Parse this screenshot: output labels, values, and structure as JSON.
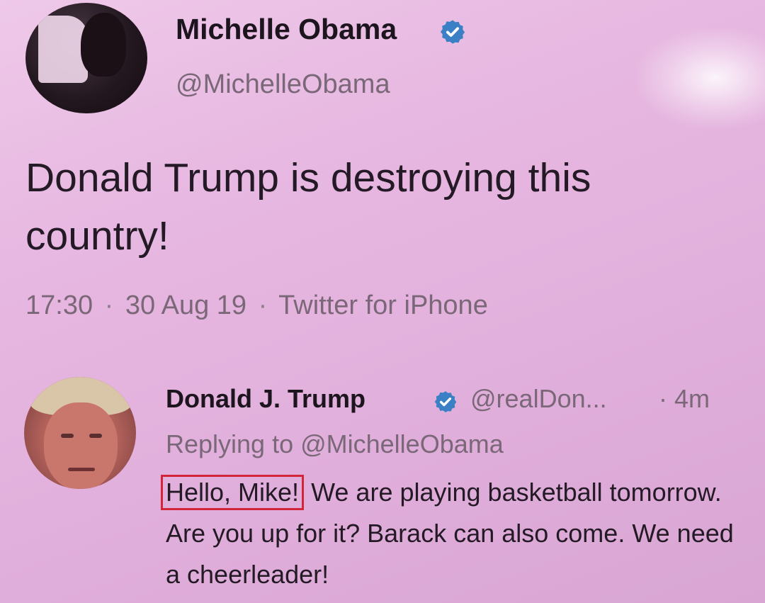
{
  "main_tweet": {
    "author_name": "Michelle Obama",
    "author_handle": "@MichelleObama",
    "verified": true,
    "text": "Donald Trump is destroying this country!",
    "time": "17:30",
    "date": "30 Aug 19",
    "source": "Twitter for iPhone",
    "separator": "·"
  },
  "reply_tweet": {
    "author_name": "Donald J. Trump",
    "author_handle": "@realDon...",
    "verified": true,
    "age": "· 4m",
    "replying_to": "Replying to @MichelleObama",
    "highlighted_text": "Hello, Mike!",
    "text": "We are playing basketball tomorrow. Are you up for it? Barack can also come. We need a cheerleader!"
  },
  "colors": {
    "background": "#e5b6df",
    "verified_badge": "#3b7fc4",
    "highlight_border": "#d4243a",
    "muted_text": "#7a6878"
  },
  "icons": {
    "verified": "verified-badge-icon"
  }
}
